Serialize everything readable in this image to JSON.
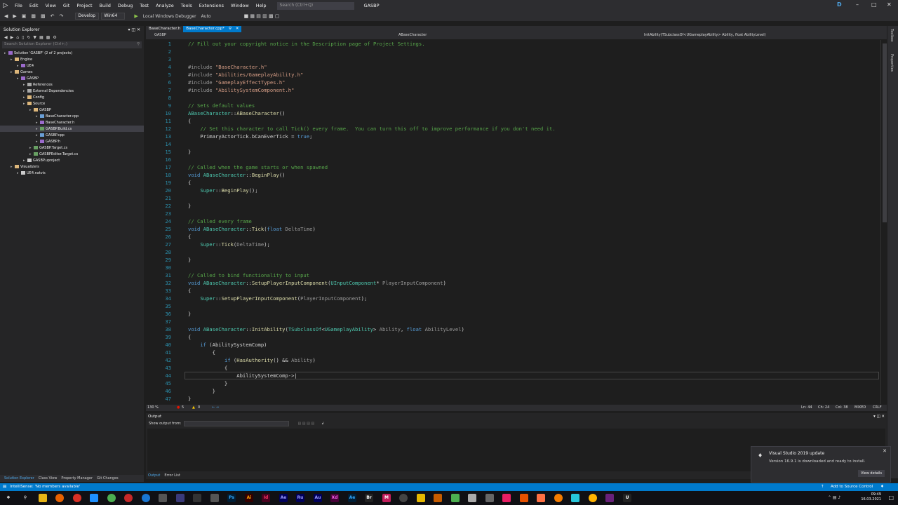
{
  "menubar": {
    "items": [
      "File",
      "Edit",
      "View",
      "Git",
      "Project",
      "Build",
      "Debug",
      "Test",
      "Analyze",
      "Tools",
      "Extensions",
      "Window",
      "Help"
    ],
    "search_placeholder": "Search (Ctrl+Q)",
    "solution_title": "GASBP",
    "user_initial": "D"
  },
  "toolbar": {
    "config": "Develop",
    "platform": "Win64",
    "debugger": "Local Windows Debugger",
    "mode": "Auto"
  },
  "solution_explorer": {
    "title": "Solution Explorer",
    "search_placeholder": "Search Solution Explorer (Ctrl+;)",
    "tree": [
      {
        "label": "Solution 'GASBP' (2 of 2 projects)",
        "indent": 0,
        "icon": "solution",
        "selected": false
      },
      {
        "label": "Engine",
        "indent": 1,
        "icon": "folder",
        "selected": false
      },
      {
        "label": "UE4",
        "indent": 2,
        "icon": "project",
        "selected": false
      },
      {
        "label": "Games",
        "indent": 1,
        "icon": "folder",
        "selected": false
      },
      {
        "label": "GASBP",
        "indent": 2,
        "icon": "project",
        "selected": false
      },
      {
        "label": "References",
        "indent": 3,
        "icon": "ref",
        "selected": false
      },
      {
        "label": "External Dependencies",
        "indent": 3,
        "icon": "ref",
        "selected": false
      },
      {
        "label": "Config",
        "indent": 3,
        "icon": "folder",
        "selected": false
      },
      {
        "label": "Source",
        "indent": 3,
        "icon": "folder",
        "selected": false
      },
      {
        "label": "GASBP",
        "indent": 4,
        "icon": "folder",
        "selected": false
      },
      {
        "label": "BaseCharacter.cpp",
        "indent": 5,
        "icon": "cpp",
        "selected": false
      },
      {
        "label": "BaseCharacter.h",
        "indent": 5,
        "icon": "h",
        "selected": false
      },
      {
        "label": "GASBP.Build.cs",
        "indent": 5,
        "icon": "cs",
        "selected": true
      },
      {
        "label": "GASBP.cpp",
        "indent": 5,
        "icon": "cpp",
        "selected": false
      },
      {
        "label": "GASBP.h",
        "indent": 5,
        "icon": "h",
        "selected": false
      },
      {
        "label": "GASBP.Target.cs",
        "indent": 4,
        "icon": "cs",
        "selected": false
      },
      {
        "label": "GASBPEditor.Target.cs",
        "indent": 4,
        "icon": "cs",
        "selected": false
      },
      {
        "label": "GASBP.uproject",
        "indent": 3,
        "icon": "file",
        "selected": false
      },
      {
        "label": "Visualizers",
        "indent": 1,
        "icon": "folder",
        "selected": false
      },
      {
        "label": "UE4.natvis",
        "indent": 2,
        "icon": "file",
        "selected": false
      }
    ],
    "bottom_tabs": [
      "Solution Explorer",
      "Class View",
      "Property Manager",
      "Git Changes"
    ]
  },
  "doc_tabs": [
    {
      "label": "BaseCharacter.h",
      "active": false
    },
    {
      "label": "BaseCharacter.cpp*",
      "active": true
    }
  ],
  "navbar": {
    "project": "GASBP",
    "scope": "ABaseCharacter",
    "member": "InitAbility(TSubclassOf<UGameplayAbility> Ability, float AbilityLevel)"
  },
  "code": [
    {
      "n": "1",
      "html": "<span class='cm'>// Fill out your copyright notice in the Description page of Project Settings.</span>"
    },
    {
      "n": "2",
      "html": ""
    },
    {
      "n": "3",
      "html": ""
    },
    {
      "n": "4",
      "html": "<span class='pp'>#include</span> <span class='st'>\"BaseCharacter.h\"</span>"
    },
    {
      "n": "5",
      "html": "<span class='pp'>#include</span> <span class='st'>\"Abilities/GameplayAbility.h\"</span>"
    },
    {
      "n": "6",
      "html": "<span class='pp'>#include</span> <span class='st'>\"GameplayEffectTypes.h\"</span>"
    },
    {
      "n": "7",
      "html": "<span class='pp'>#include</span> <span class='st'>\"AbilitySystemComponent.h\"</span>"
    },
    {
      "n": "8",
      "html": ""
    },
    {
      "n": "9",
      "html": "<span class='cm'>// Sets default values</span>"
    },
    {
      "n": "10",
      "html": "<span class='ty'>ABaseCharacter</span>::<span class='fn'>ABaseCharacter</span>()"
    },
    {
      "n": "11",
      "html": "{"
    },
    {
      "n": "12",
      "html": "    <span class='cm'>// Set this character to call Tick() every frame.  You can turn this off to improve performance if you don't need it.</span>"
    },
    {
      "n": "13",
      "html": "    PrimaryActorTick.bCanEverTick = <span class='kw'>true</span>;"
    },
    {
      "n": "14",
      "html": ""
    },
    {
      "n": "15",
      "html": "}"
    },
    {
      "n": "16",
      "html": ""
    },
    {
      "n": "17",
      "html": "<span class='cm'>// Called when the game starts or when spawned</span>"
    },
    {
      "n": "18",
      "html": "<span class='kw'>void</span> <span class='ty'>ABaseCharacter</span>::<span class='fn'>BeginPlay</span>()"
    },
    {
      "n": "19",
      "html": "{"
    },
    {
      "n": "20",
      "html": "    <span class='ty'>Super</span>::<span class='fn'>BeginPlay</span>();"
    },
    {
      "n": "21",
      "html": ""
    },
    {
      "n": "22",
      "html": "}"
    },
    {
      "n": "23",
      "html": ""
    },
    {
      "n": "24",
      "html": "<span class='cm'>// Called every frame</span>"
    },
    {
      "n": "25",
      "html": "<span class='kw'>void</span> <span class='ty'>ABaseCharacter</span>::<span class='fn'>Tick</span>(<span class='kw'>float</span> <span class='pa'>DeltaTime</span>)"
    },
    {
      "n": "26",
      "html": "{"
    },
    {
      "n": "27",
      "html": "    <span class='ty'>Super</span>::<span class='fn'>Tick</span>(<span class='pa'>DeltaTime</span>);"
    },
    {
      "n": "28",
      "html": ""
    },
    {
      "n": "29",
      "html": "}"
    },
    {
      "n": "30",
      "html": ""
    },
    {
      "n": "31",
      "html": "<span class='cm'>// Called to bind functionality to input</span>"
    },
    {
      "n": "32",
      "html": "<span class='kw'>void</span> <span class='ty'>ABaseCharacter</span>::<span class='fn'>SetupPlayerInputComponent</span>(<span class='ty'>UInputComponent</span>* <span class='pa'>PlayerInputComponent</span>)"
    },
    {
      "n": "33",
      "html": "{"
    },
    {
      "n": "34",
      "html": "    <span class='ty'>Super</span>::<span class='fn'>SetupPlayerInputComponent</span>(<span class='pa'>PlayerInputComponent</span>);"
    },
    {
      "n": "35",
      "html": ""
    },
    {
      "n": "36",
      "html": "}"
    },
    {
      "n": "37",
      "html": ""
    },
    {
      "n": "38",
      "html": "<span class='kw'>void</span> <span class='ty'>ABaseCharacter</span>::<span class='fn'>InitAbility</span>(<span class='ty'>TSubclassOf</span>&lt;<span class='ty'>UGameplayAbility</span>&gt; <span class='pa'>Ability</span>, <span class='kw'>float</span> <span class='pa'>AbilityLevel</span>)"
    },
    {
      "n": "39",
      "html": "{"
    },
    {
      "n": "40",
      "html": "    <span class='kw'>if</span> (AbilitySystemComp)"
    },
    {
      "n": "41",
      "html": "        {"
    },
    {
      "n": "42",
      "html": "            <span class='kw'>if</span> (<span class='fn'>HasAuthority</span>() &amp;&amp; <span class='pa'>Ability</span>)"
    },
    {
      "n": "43",
      "html": "            {"
    },
    {
      "n": "44",
      "html": "                AbilitySystemComp-&gt;|"
    },
    {
      "n": "45",
      "html": "            }"
    },
    {
      "n": "46",
      "html": "        }"
    },
    {
      "n": "47",
      "html": "}"
    }
  ],
  "editor_status": {
    "zoom": "130 %",
    "errors": "5",
    "warnings": "0",
    "line": "Ln: 44",
    "char": "Ch: 24",
    "col": "Col: 38",
    "mixed": "MIXED",
    "eol": "CRLF"
  },
  "output": {
    "title": "Output",
    "show_from": "Show output from:",
    "tabs": [
      "Output",
      "Error List"
    ]
  },
  "notification": {
    "title": "Visual Studio 2019 update",
    "message": "Version 16.9.1 is downloaded and ready to install.",
    "button": "View details"
  },
  "statusbar": {
    "left": "IntelliSense: 'No members available'",
    "right": "Add to Source Control"
  },
  "rightbar": {
    "toolbox": "Toolbox",
    "properties": "Properties"
  },
  "taskbar": {
    "time": "09:49",
    "date": "16.03.2021"
  }
}
